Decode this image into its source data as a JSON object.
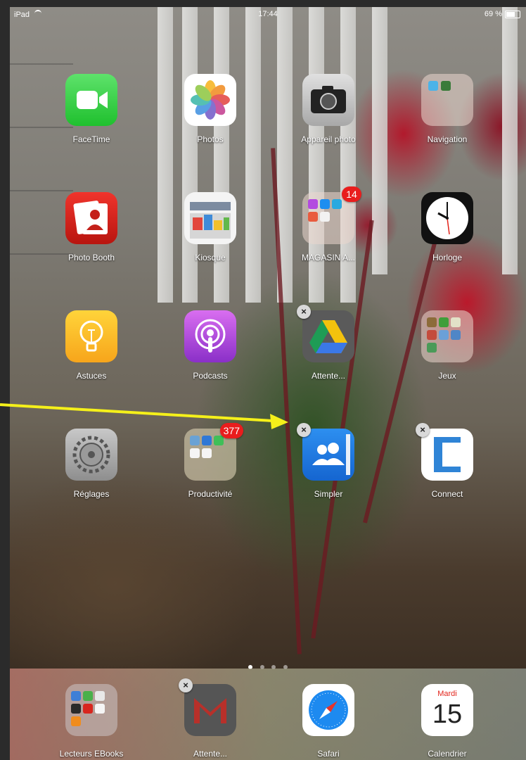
{
  "status_bar": {
    "device": "iPad",
    "time": "17:44",
    "battery": "69 %"
  },
  "apps": {
    "facetime": {
      "label": "FaceTime"
    },
    "photos": {
      "label": "Photos"
    },
    "camera": {
      "label": "Appareil photo"
    },
    "navigation": {
      "label": "Navigation"
    },
    "photobooth": {
      "label": "Photo Booth"
    },
    "kiosque": {
      "label": "Kiosque"
    },
    "magasin": {
      "label": "MAGASIN A...",
      "badge": "14"
    },
    "horloge": {
      "label": "Horloge"
    },
    "astuces": {
      "label": "Astuces"
    },
    "podcasts": {
      "label": "Podcasts"
    },
    "attente1": {
      "label": "Attente..."
    },
    "jeux": {
      "label": "Jeux"
    },
    "reglages": {
      "label": "Réglages"
    },
    "productivite": {
      "label": "Productivité",
      "badge": "377"
    },
    "simpler": {
      "label": "Simpler"
    },
    "connect": {
      "label": "Connect"
    }
  },
  "dock": {
    "ebooks": {
      "label": "Lecteurs EBooks"
    },
    "attente2": {
      "label": "Attente..."
    },
    "safari": {
      "label": "Safari"
    },
    "calendrier": {
      "label": "Calendrier",
      "day_name": "Mardi",
      "day_number": "15"
    }
  },
  "delete_glyph": "×",
  "colors": {
    "badge": "#e91d1d",
    "annotation_arrow": "#f5f01a"
  },
  "page_indicator": {
    "pages": 4,
    "current": 1
  }
}
